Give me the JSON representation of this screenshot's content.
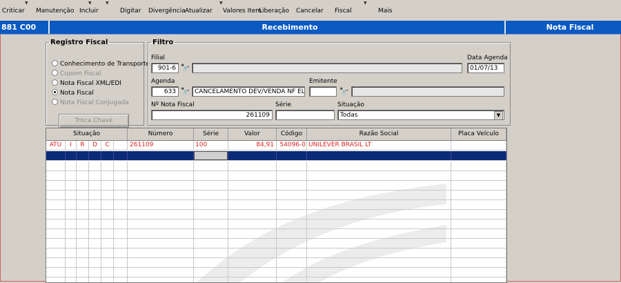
{
  "toolbar": {
    "items": [
      "Criticar",
      "Manutenção",
      "Incluir",
      "Digitar",
      "Divergência",
      "Atualizar",
      "Valores Item",
      "Liberação",
      "Cancelar",
      "Fiscal",
      "Mais"
    ]
  },
  "titlebar": {
    "left": "881 C00",
    "center": "Recebimento",
    "right": "Nota Fiscal"
  },
  "registro": {
    "title": "Registro Fiscal",
    "options": [
      {
        "label": "Conhecimento de Transporte",
        "selected": false,
        "disabled": false
      },
      {
        "label": "Cupom Fiscal",
        "selected": false,
        "disabled": true
      },
      {
        "label": "Nota Fiscal XML/EDI",
        "selected": false,
        "disabled": false
      },
      {
        "label": "Nota Fiscal",
        "selected": true,
        "disabled": false
      },
      {
        "label": "Nota Fiscal Conjugada",
        "selected": false,
        "disabled": true
      }
    ],
    "troca_label": "Troca Chave"
  },
  "filtro": {
    "title": "Filtro",
    "filial_label": "Filial",
    "filial_value": "901-6",
    "filial_desc": "",
    "data_agenda_label": "Data Agenda",
    "data_agenda_value": "01/07/13",
    "agenda_label": "Agenda",
    "agenda_value": "633",
    "agenda_desc": "CANCELAMENTO DEV/VENDA NF ELET",
    "emitente_label": "Emitente",
    "emitente_value": "",
    "emitente_desc": "",
    "nf_label": "Nº Nota Fiscal",
    "nf_value": "261109",
    "serie_label": "Série",
    "serie_value": "",
    "situacao_label": "Situação",
    "situacao_value": "Todas"
  },
  "grid": {
    "headers": [
      "Situação",
      "Número",
      "Série",
      "Valor",
      "Código",
      "Razão Social",
      "Placa Veículo"
    ],
    "rows": [
      {
        "flags": [
          "ATU",
          "I",
          "R",
          "D",
          "C",
          ""
        ],
        "numero": "261109",
        "serie": "100",
        "valor": "84,91",
        "codigo": "54096-0",
        "razao": "UNILEVER BRASIL LT",
        "placa": ""
      }
    ]
  },
  "icons": {
    "binoculars": "binoculars-icon",
    "dropdown": "chevron-down-icon"
  },
  "colors": {
    "titlebar": "#0a5ac2",
    "selected_row": "#0b2a78",
    "row_text": "#e02020"
  }
}
